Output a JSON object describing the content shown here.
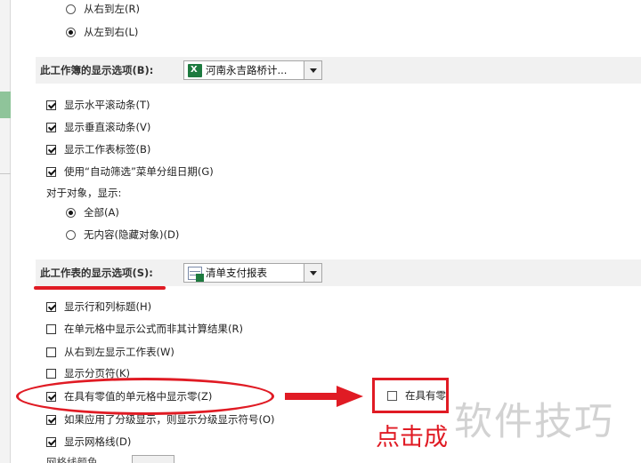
{
  "direction": {
    "rtl": "从右到左(R)",
    "ltr": "从左到右(L)"
  },
  "workbook": {
    "header": "此工作簿的显示选项(B):",
    "selected": "河南永吉路桥计...",
    "options": [
      {
        "label": "显示水平滚动条(T)",
        "checked": true
      },
      {
        "label": "显示垂直滚动条(V)",
        "checked": true
      },
      {
        "label": "显示工作表标签(B)",
        "checked": true
      },
      {
        "label": "使用“自动筛选”菜单分组日期(G)",
        "checked": true
      }
    ],
    "objects_label": "对于对象，显示:",
    "objects_all": "全部(A)",
    "objects_none": "无内容(隐藏对象)(D)"
  },
  "worksheet": {
    "header": "此工作表的显示选项(S):",
    "selected": "清单支付报表",
    "options": [
      {
        "label": "显示行和列标题(H)",
        "checked": true
      },
      {
        "label": "在单元格中显示公式而非其计算结果(R)",
        "checked": false
      },
      {
        "label": "从右到左显示工作表(W)",
        "checked": false
      },
      {
        "label": "显示分页符(K)",
        "checked": false
      },
      {
        "label": "在具有零值的单元格中显示零(Z)",
        "checked": true
      },
      {
        "label": "如果应用了分级显示，则显示分级显示符号(O)",
        "checked": true
      },
      {
        "label": "显示网格线(D)",
        "checked": true
      }
    ],
    "gridline_color_label": "网格线颜色"
  },
  "annotation": {
    "zoom_text": "在具有零",
    "caption": "点击成",
    "color": "#e01b24"
  },
  "watermark": "软件技巧"
}
